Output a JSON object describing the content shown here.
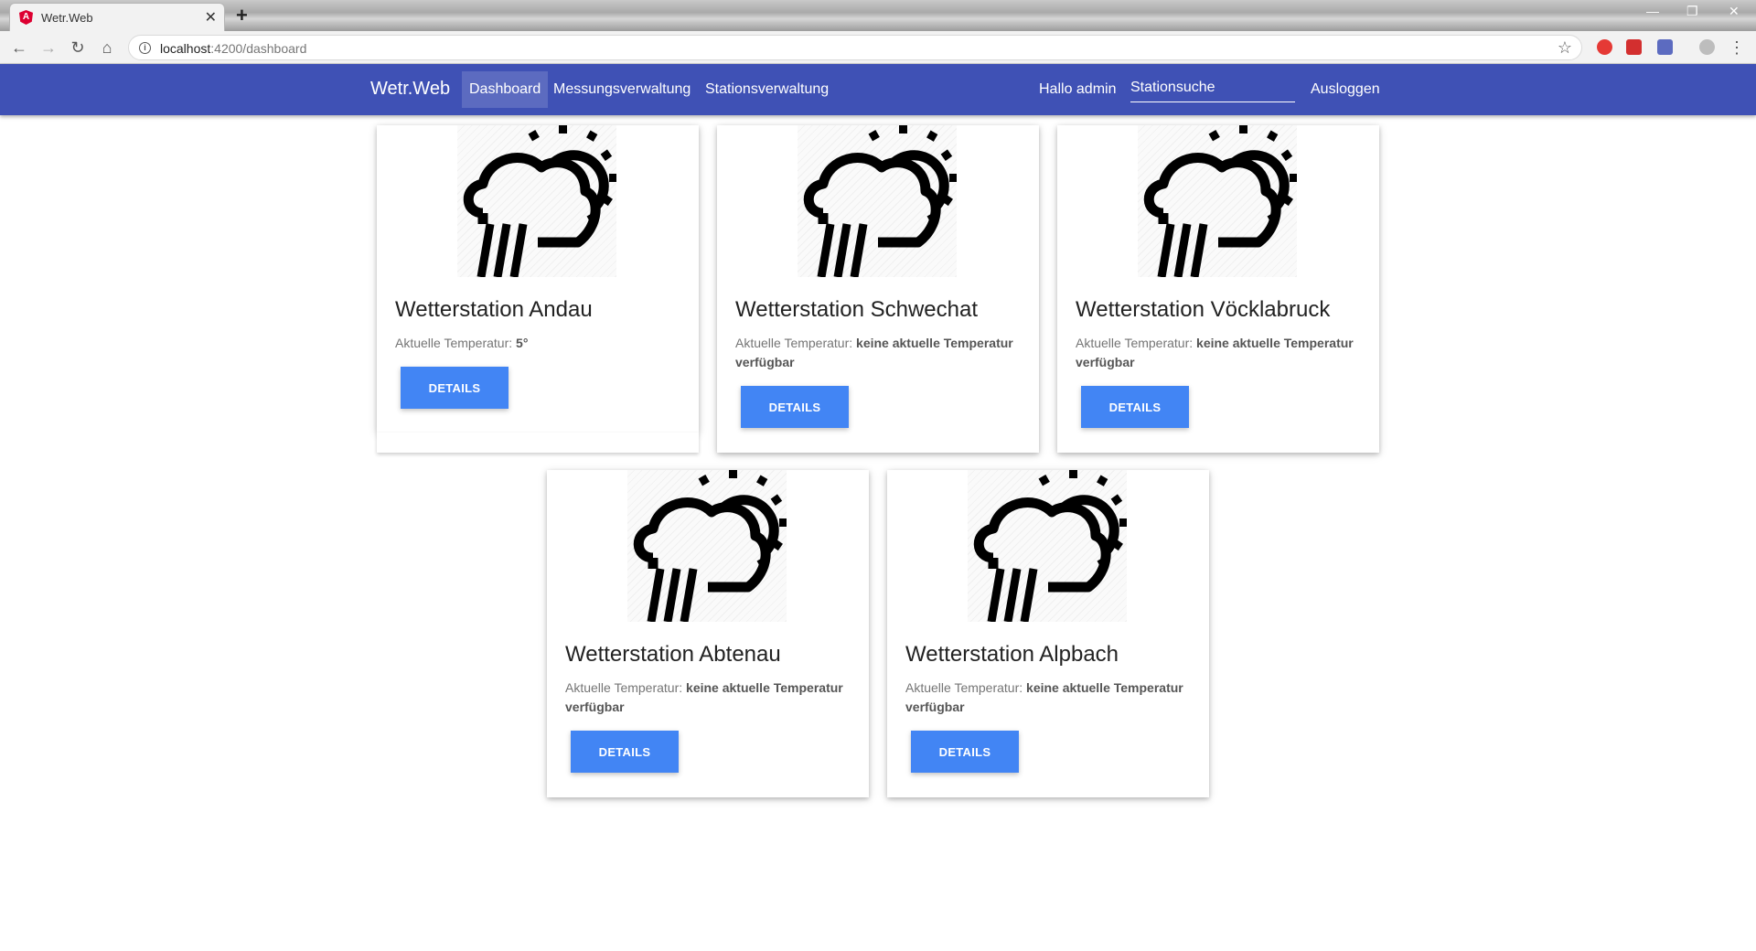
{
  "browser": {
    "tab_title": "Wetr.Web",
    "url_host": "localhost",
    "url_path": ":4200/dashboard"
  },
  "navbar": {
    "brand": "Wetr.Web",
    "links": [
      "Dashboard",
      "Messungsverwaltung",
      "Stationsverwaltung"
    ],
    "active_link": "Dashboard",
    "greeting": "Hallo admin",
    "search_placeholder": "Stationsuche",
    "logout": "Ausloggen",
    "color": "#3f51b5"
  },
  "stations": [
    {
      "name": "Wetterstation Andau",
      "temp_label": "Aktuelle Temperatur:",
      "temp_value": "5°",
      "button": "Details",
      "icon": "rain-sun-cloud-icon"
    },
    {
      "name": "Wetterstation Schwechat",
      "temp_label": "Aktuelle Temperatur:",
      "temp_value": "keine aktuelle Temperatur verfügbar",
      "button": "Details",
      "icon": "rain-sun-cloud-icon"
    },
    {
      "name": "Wetterstation Vöcklabruck",
      "temp_label": "Aktuelle Temperatur:",
      "temp_value": "keine aktuelle Temperatur verfügbar",
      "button": "Details",
      "icon": "rain-sun-cloud-icon"
    },
    {
      "name": "Wetterstation Abtenau",
      "temp_label": "Aktuelle Temperatur:",
      "temp_value": "keine aktuelle Temperatur verfügbar",
      "button": "Details",
      "icon": "rain-sun-cloud-icon"
    },
    {
      "name": "Wetterstation Alpbach",
      "temp_label": "Aktuelle Temperatur:",
      "temp_value": "keine aktuelle Temperatur verfügbar",
      "button": "Details",
      "icon": "rain-sun-cloud-icon"
    }
  ],
  "button_color": "#4285f4"
}
